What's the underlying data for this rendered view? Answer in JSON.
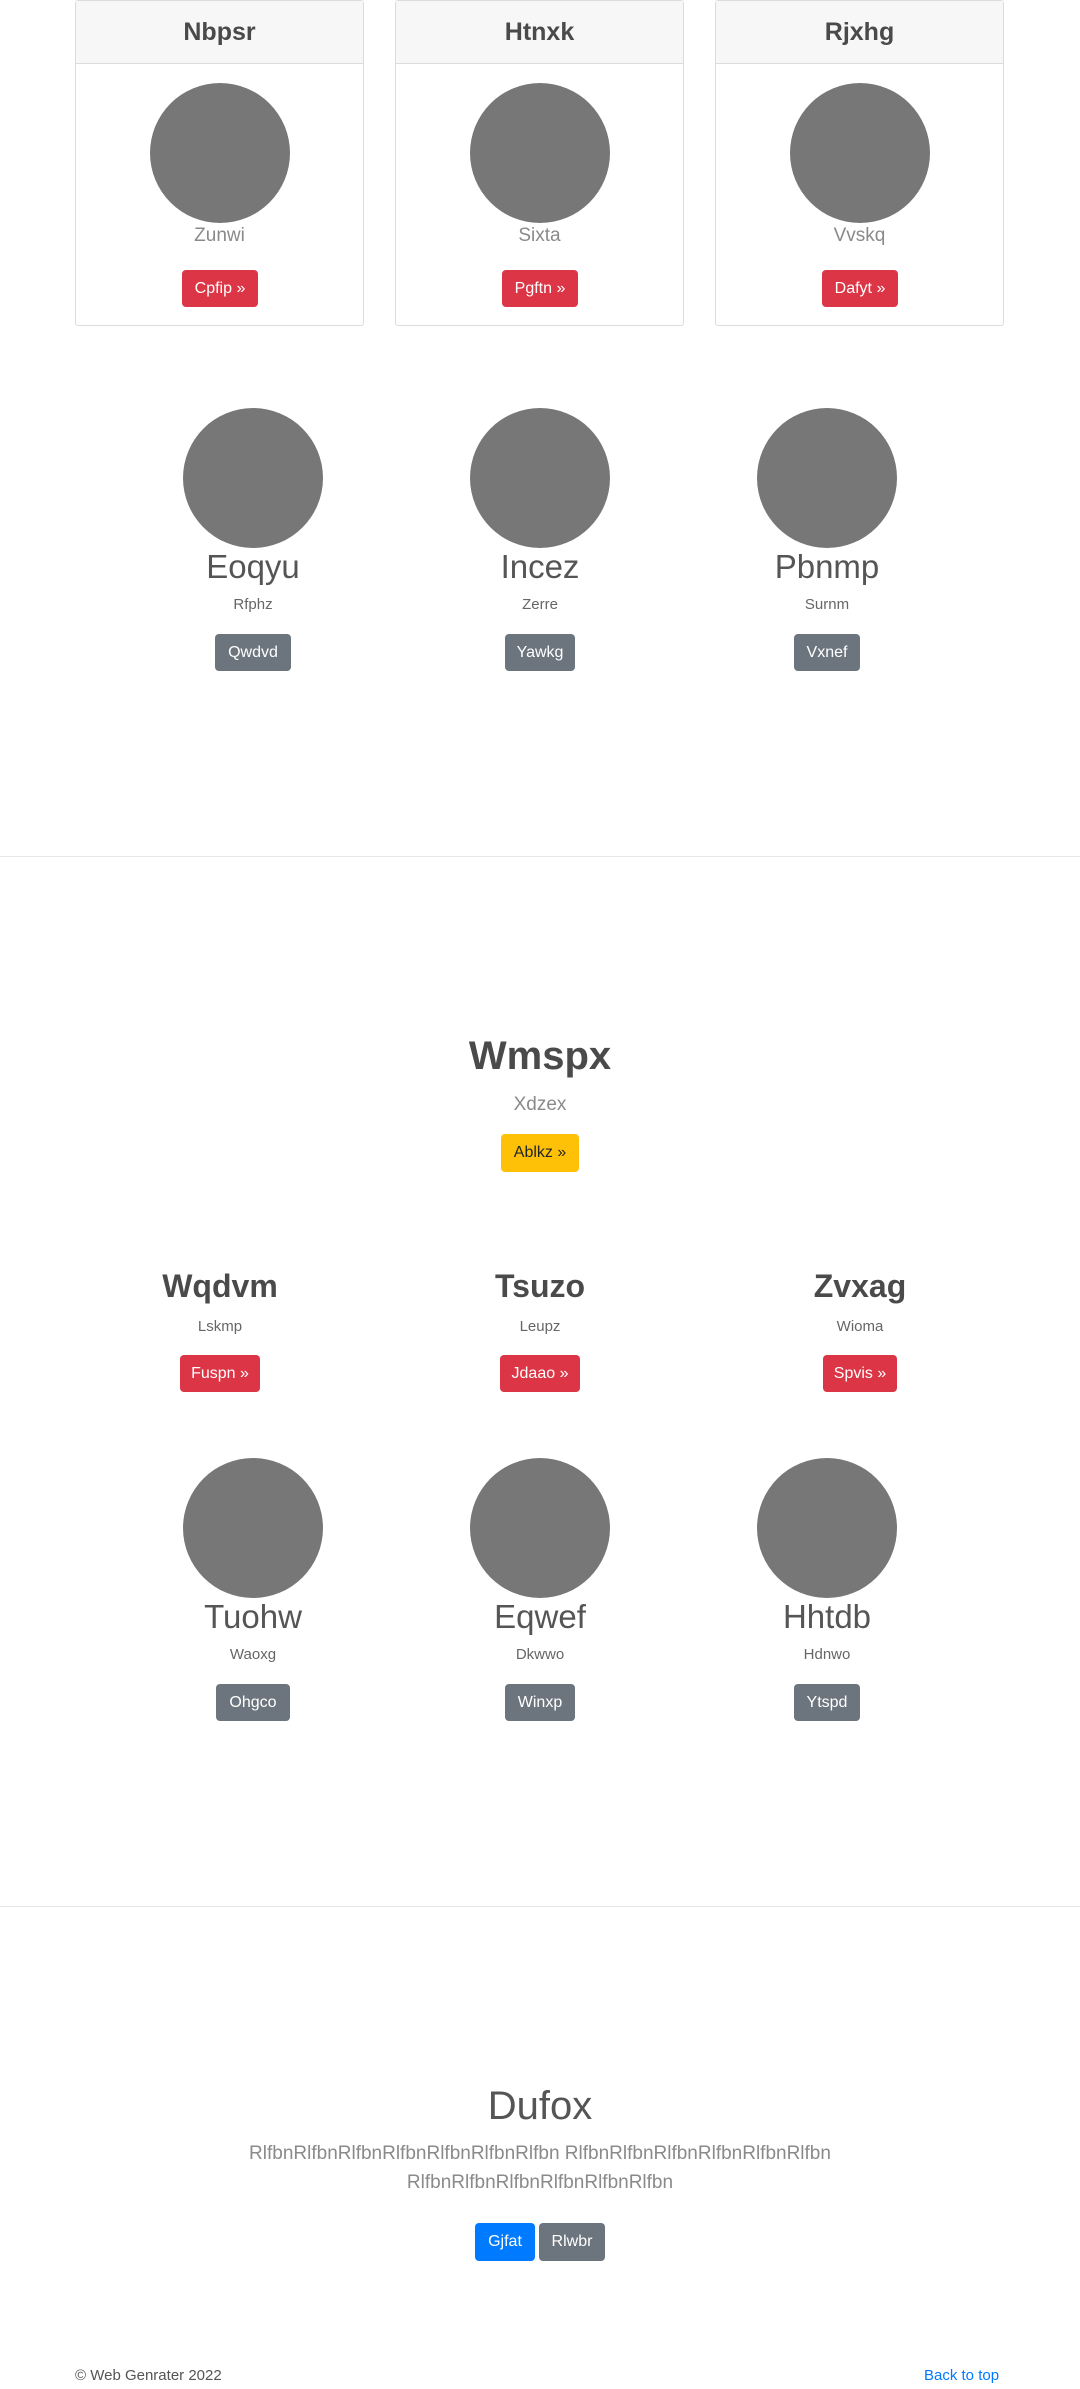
{
  "cards": [
    {
      "title": "Nbpsr",
      "subtitle": "Zunwi",
      "button": "Cpfip »"
    },
    {
      "title": "Htnxk",
      "subtitle": "Sixta",
      "button": "Pgftn »"
    },
    {
      "title": "Rjxhg",
      "subtitle": "Vvskq",
      "button": "Dafyt »"
    }
  ],
  "team1": [
    {
      "name": "Eoqyu",
      "role": "Rfphz",
      "button": "Qwdvd"
    },
    {
      "name": "Incez",
      "role": "Zerre",
      "button": "Yawkg"
    },
    {
      "name": "Pbnmp",
      "role": "Surnm",
      "button": "Vxnef"
    }
  ],
  "hero": {
    "title": "Wmspx",
    "subtitle": "Xdzex",
    "button": "Ablkz »"
  },
  "features": [
    {
      "title": "Wqdvm",
      "subtitle": "Lskmp",
      "button": "Fuspn »"
    },
    {
      "title": "Tsuzo",
      "subtitle": "Leupz",
      "button": "Jdaao »"
    },
    {
      "title": "Zvxag",
      "subtitle": "Wioma",
      "button": "Spvis »"
    }
  ],
  "team2": [
    {
      "name": "Tuohw",
      "role": "Waoxg",
      "button": "Ohgco"
    },
    {
      "name": "Eqwef",
      "role": "Dkwwo",
      "button": "Winxp"
    },
    {
      "name": "Hhtdb",
      "role": "Hdnwo",
      "button": "Ytspd"
    }
  ],
  "cta": {
    "title": "Dufox",
    "line1": "RlfbnRlfbnRlfbnRlfbnRlfbnRlfbnRlfbn RlfbnRlfbnRlfbnRlfbnRlfbnRlfbn",
    "line2": "RlfbnRlfbnRlfbnRlfbnRlfbnRlfbn",
    "primary_button": "Gjfat",
    "secondary_button": "Rlwbr"
  },
  "footer": {
    "copyright": "© Web Genrater 2022",
    "back_to_top": "Back to top"
  },
  "colors": {
    "danger": "#dc3545",
    "secondary": "#6c757d",
    "warning": "#ffc107",
    "primary": "#007bff",
    "avatar": "#777777"
  }
}
